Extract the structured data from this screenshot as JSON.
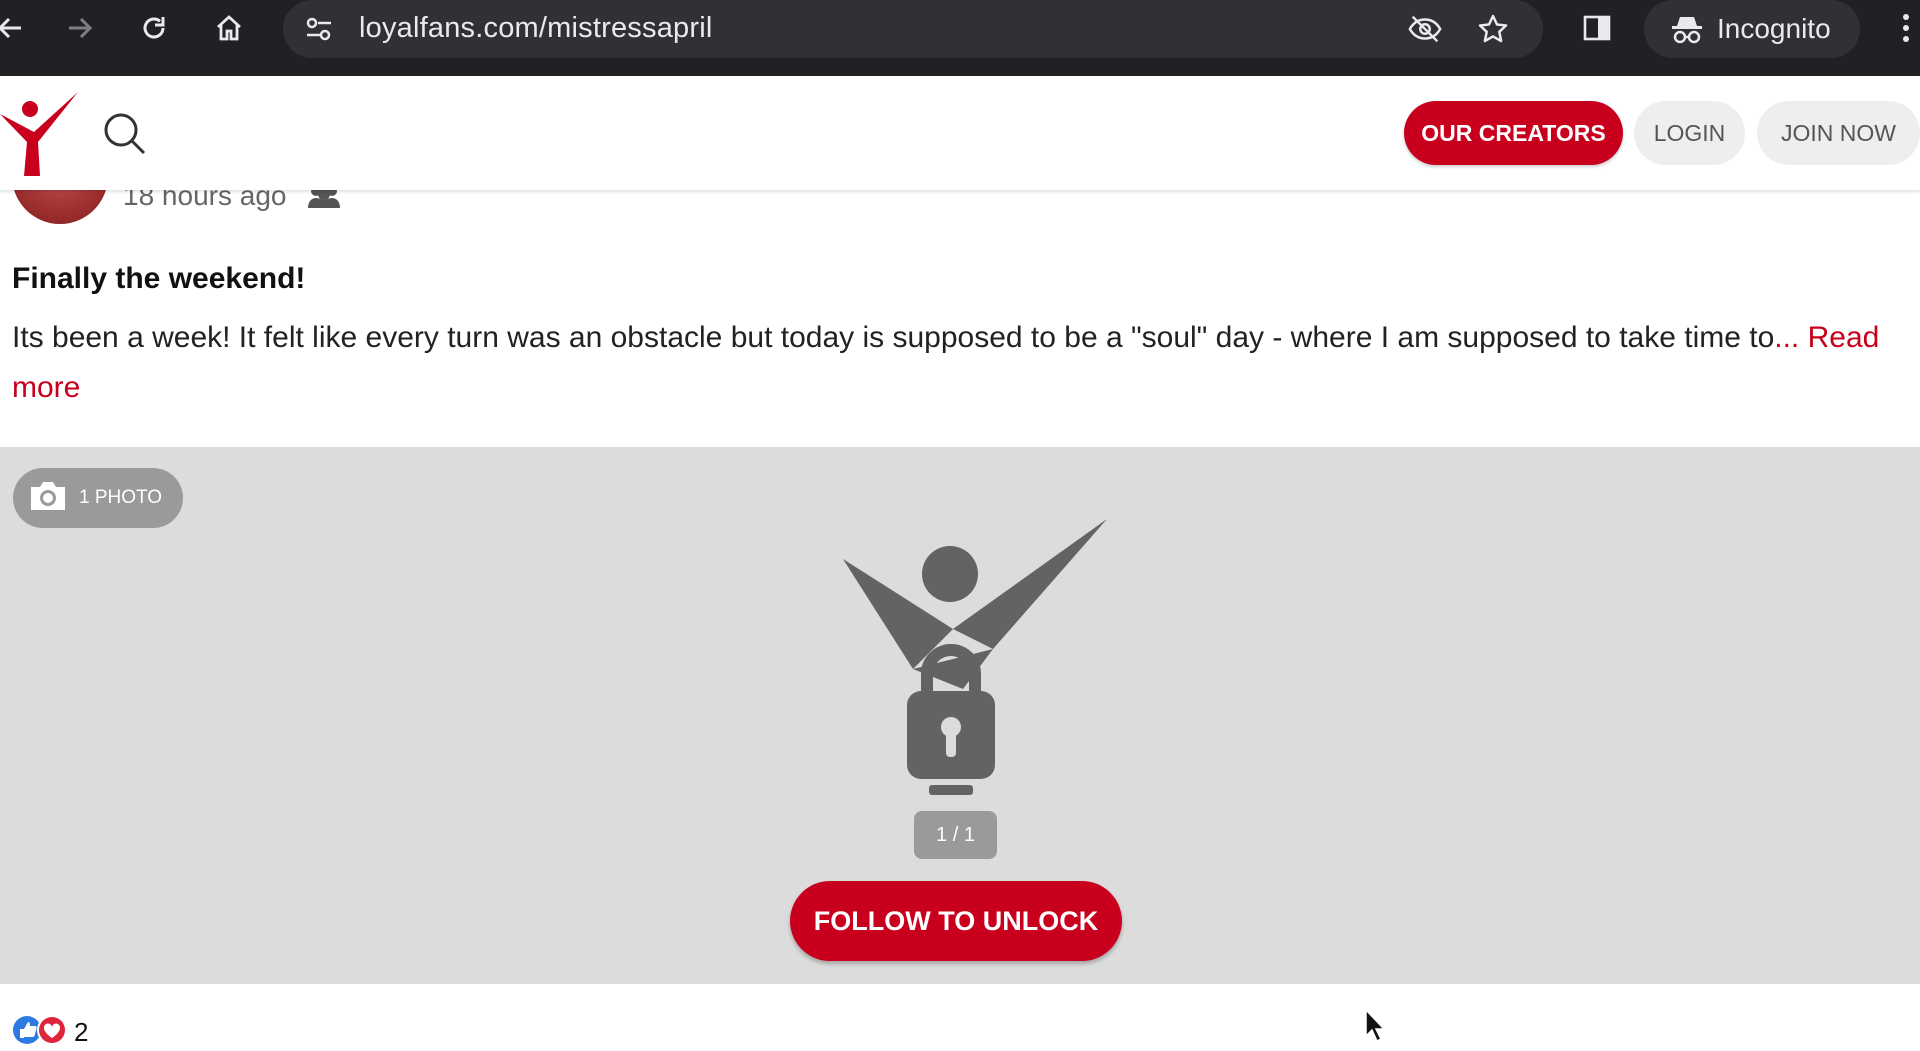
{
  "browser": {
    "url": "loyalfans.com/mistressapril",
    "incognito_label": "Incognito"
  },
  "header": {
    "creators_label": "OUR CREATORS",
    "login_label": "LOGIN",
    "join_label": "JOIN NOW"
  },
  "post": {
    "timestamp": "18 hours ago",
    "title": "Finally the weekend!",
    "text": "Its been a week! It felt like every turn was an obstacle but today is supposed to be a \"soul\" day - where I am supposed to take time to",
    "ellipsis": "... ",
    "read_more": "Read more",
    "photo_badge": "1 PHOTO",
    "counter": "1 / 1",
    "unlock_label": "FOLLOW TO UNLOCK",
    "reaction_count": "2"
  },
  "colors": {
    "brand": "#c8001e",
    "chrome_bg": "#202124",
    "media_bg": "#dcdcdc"
  }
}
